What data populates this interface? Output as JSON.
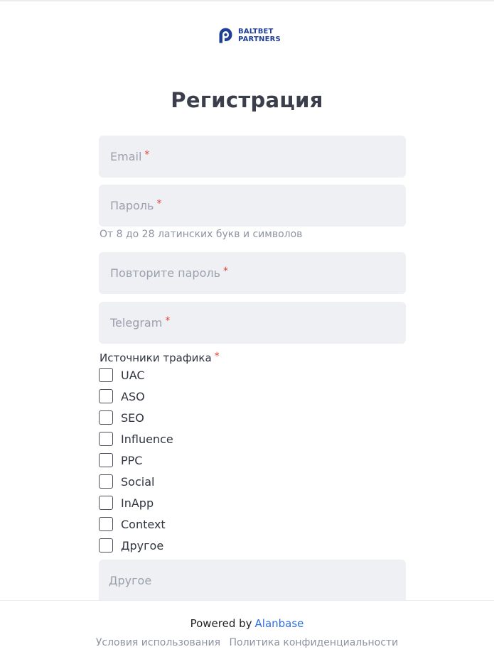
{
  "brand": {
    "line1": "BALTBET",
    "line2": "PARTNERS",
    "color": "#1f3f95"
  },
  "form": {
    "title": "Регистрация",
    "email_placeholder": "Email",
    "password_placeholder": "Пароль",
    "password_hint": "От 8 до 28 латинских букв и символов",
    "repeat_password_placeholder": "Повторите пароль",
    "telegram_placeholder": "Telegram",
    "required_mark": "*",
    "traffic_label": "Источники трафика",
    "traffic_options": [
      "UAC",
      "ASO",
      "SEO",
      "Influence",
      "PPC",
      "Social",
      "InApp",
      "Context",
      "Другое"
    ],
    "other_placeholder": "Другое"
  },
  "footer": {
    "powered_by": "Powered by",
    "powered_link": "Alanbase",
    "terms": "Условия использования",
    "privacy": "Политика конфиденциальности"
  },
  "colors": {
    "field_bg": "#eff0f4",
    "required": "#e2443b",
    "link": "#2f6ee6"
  }
}
